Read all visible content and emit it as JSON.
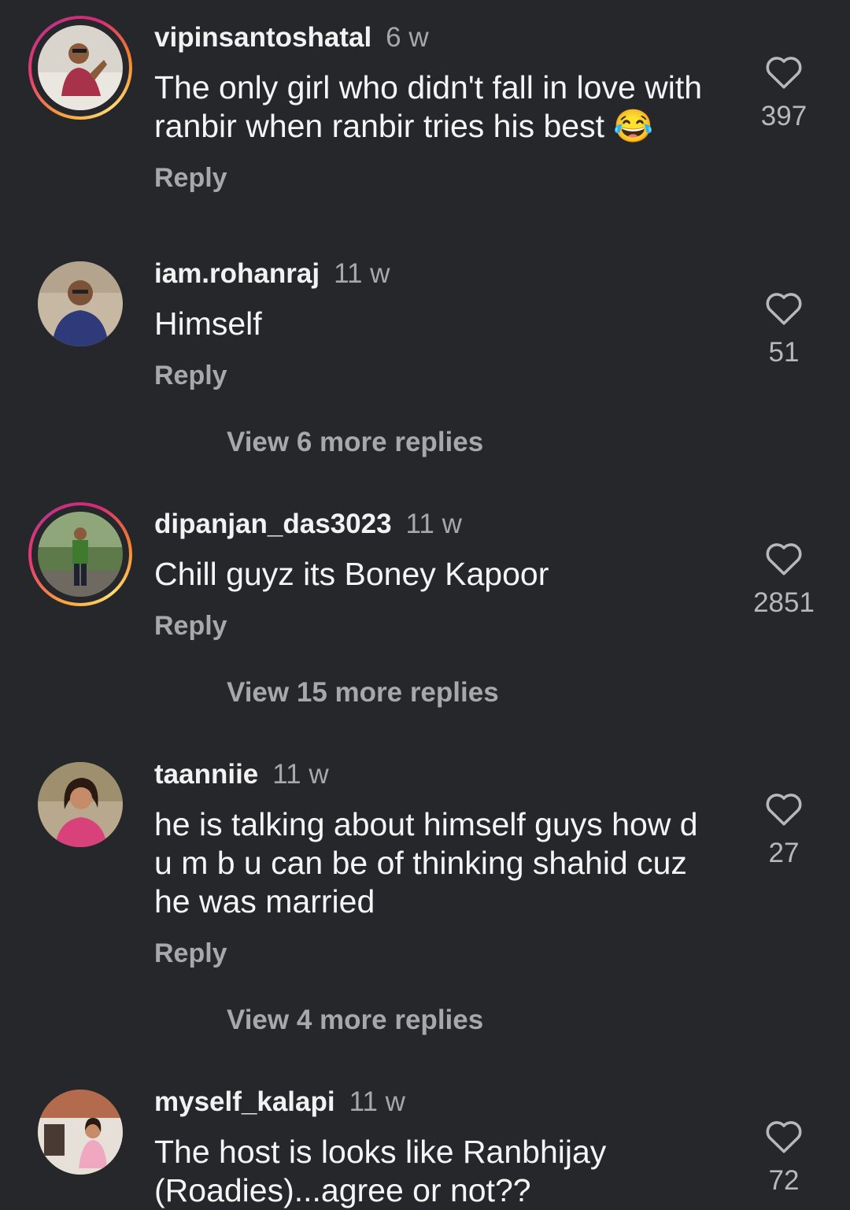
{
  "comments": [
    {
      "username": "vipinsantoshatal",
      "time": "6 w",
      "text": "The only girl who didn't fall in love with ranbir when ranbir tries his best 😂",
      "reply": "Reply",
      "likes": "397",
      "has_story_ring": true
    },
    {
      "username": "iam.rohanraj",
      "time": "11 w",
      "text": "Himself",
      "reply": "Reply",
      "likes": "51",
      "has_story_ring": false,
      "view_replies": "View 6 more replies"
    },
    {
      "username": "dipanjan_das3023",
      "time": "11 w",
      "text": "Chill guyz its Boney Kapoor",
      "reply": "Reply",
      "likes": "2851",
      "has_story_ring": true,
      "view_replies": "View 15 more replies"
    },
    {
      "username": "taanniie",
      "time": "11 w",
      "text": "he is talking about himself guys how d u m b u can be of thinking shahid cuz he was married",
      "reply": "Reply",
      "likes": "27",
      "has_story_ring": false,
      "view_replies": "View 4 more replies"
    },
    {
      "username": "myself_kalapi",
      "time": "11 w",
      "text": "The host is looks like Ranbhijay (Roadies)...agree or not??",
      "likes": "72",
      "has_story_ring": false
    }
  ],
  "colors": {
    "background": "#26272b",
    "primary_text": "#f5f5f5",
    "secondary_text": "#a8a8ac",
    "ring_gradient": [
      "#feda75",
      "#f58529",
      "#d62976",
      "#c13584"
    ]
  },
  "icons": {
    "like": "heart-outline-icon"
  }
}
